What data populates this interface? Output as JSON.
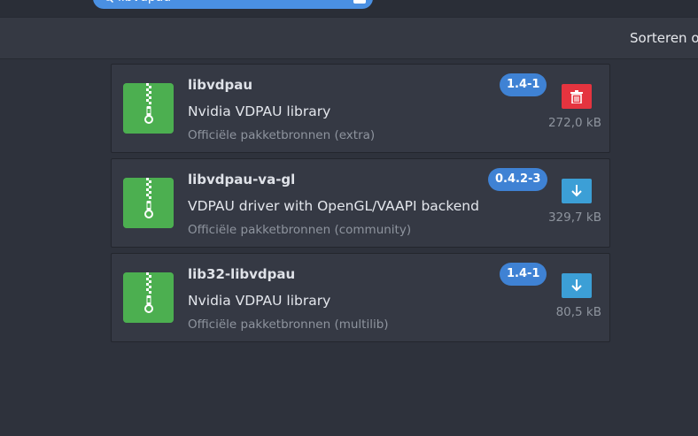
{
  "search": {
    "query": "libvdpau"
  },
  "toolbar": {
    "sort_label": "Sorteren o"
  },
  "packages": [
    {
      "name": "libvdpau",
      "description": "Nvidia VDPAU library",
      "repository": "Officiële pakketbronnen (extra)",
      "version": "1.4-1",
      "size": "272,0 kB",
      "action": "remove",
      "icon": "archive-zip-icon"
    },
    {
      "name": "libvdpau-va-gl",
      "description": "VDPAU driver with OpenGL/VAAPI backend",
      "repository": "Officiële pakketbronnen (community)",
      "version": "0.4.2-3",
      "size": "329,7 kB",
      "action": "install",
      "icon": "archive-zip-icon"
    },
    {
      "name": "lib32-libvdpau",
      "description": "Nvidia VDPAU library",
      "repository": "Officiële pakketbronnen (multilib)",
      "version": "1.4-1",
      "size": "80,5 kB",
      "action": "install",
      "icon": "archive-zip-icon"
    }
  ],
  "colors": {
    "search_accent": "#4a90e2",
    "version_badge": "#3f82d4",
    "remove_button": "#e5343f",
    "install_button": "#3c9fd6",
    "package_icon": "#4caf50"
  }
}
